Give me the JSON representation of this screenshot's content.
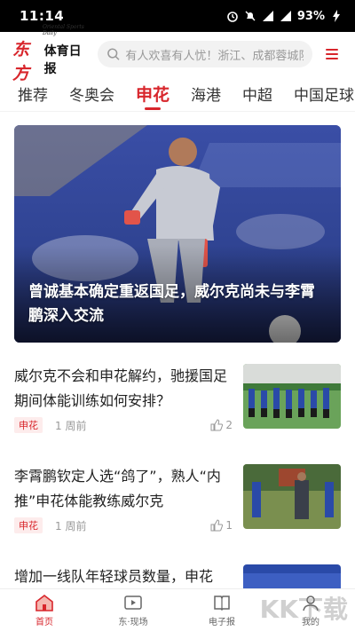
{
  "status_bar": {
    "time": "11:14",
    "battery": "93%"
  },
  "header": {
    "logo_red": "东方",
    "logo_black": "体育日报",
    "logo_en": "Oriental Sports Daily",
    "search_placeholder": "有人欢喜有人忧！浙江、成都蓉城队"
  },
  "tabs": [
    {
      "label": "推荐",
      "active": false
    },
    {
      "label": "冬奥会",
      "active": false
    },
    {
      "label": "申花",
      "active": true
    },
    {
      "label": "海港",
      "active": false
    },
    {
      "label": "中超",
      "active": false
    },
    {
      "label": "中国足球",
      "active": false
    }
  ],
  "hero": {
    "title": "曾诚基本确定重返国足，威尔克尚未与李霄鹏深入交流"
  },
  "news": [
    {
      "title": "威尔克不会和申花解约，驰援国足期间体能训练如何安排？",
      "tag": "申花",
      "time": "1 周前",
      "likes": "2"
    },
    {
      "title": "李霄鹏钦定人选“鸽了”，熟人“内推”申花体能教练威尔克",
      "tag": "申花",
      "time": "1 周前",
      "likes": "1"
    },
    {
      "title": "增加一线队年轻球员数量，申花",
      "tag": "",
      "time": "",
      "likes": ""
    }
  ],
  "bottom_nav": [
    {
      "label": "首页",
      "icon": "home-icon",
      "active": true
    },
    {
      "label": "东·现场",
      "icon": "video-icon",
      "active": false
    },
    {
      "label": "电子报",
      "icon": "newspaper-icon",
      "active": false
    },
    {
      "label": "我的",
      "icon": "user-icon",
      "active": false
    }
  ],
  "watermark": "KK下载",
  "colors": {
    "accent": "#d8262c"
  }
}
